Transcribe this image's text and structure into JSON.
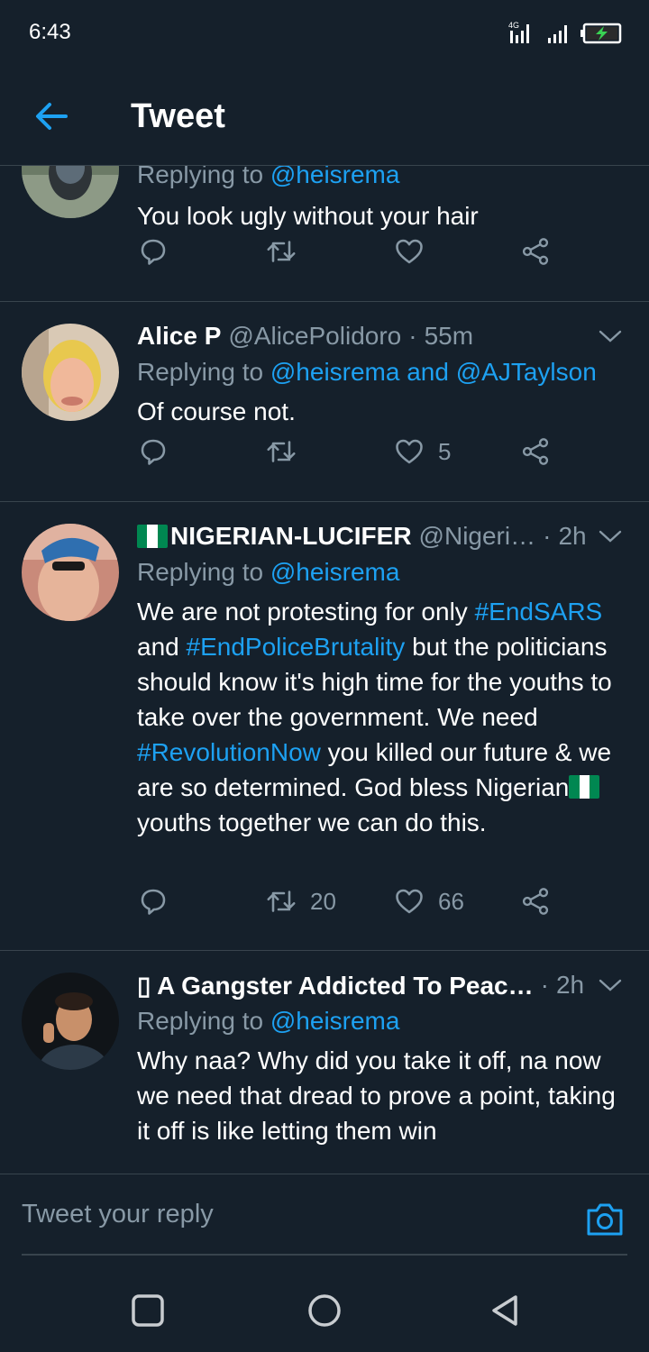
{
  "status_bar": {
    "time": "6:43",
    "network": "4G"
  },
  "header": {
    "title": "Tweet"
  },
  "tweets": [
    {
      "reply_prefix": "Replying to",
      "reply_to": "@heisrema",
      "text": "You look ugly without your hair"
    },
    {
      "name": "Alice P",
      "handle": "@AlicePolidoro",
      "sep": "·",
      "time": "55m",
      "reply_prefix": "Replying to",
      "reply_to": "@heisrema and @AJTaylson",
      "text": "Of course not.",
      "likes": "5"
    },
    {
      "name": "NIGERIAN-LUCIFER",
      "handle": "@Nigeri…",
      "sep": "·",
      "time": "2h",
      "reply_prefix": "Replying to",
      "reply_to": "@heisrema",
      "text_parts": {
        "p1": "We are not protesting for only ",
        "h1": "#EndSARS",
        "p2": " and ",
        "h2": "#EndPoliceBrutality",
        "p3": " but the politicians should know it's high time for the youths to take over the government. We need ",
        "h3": "#RevolutionNow",
        "p4": " you killed our future & we are so determined. God bless Nigerian",
        "p5": " youths together we can do this."
      },
      "retweets": "20",
      "likes": "66"
    },
    {
      "name": "▯ A Gangster Addicted To Peac…",
      "sep": "·",
      "time": "2h",
      "reply_prefix": "Replying to",
      "reply_to": "@heisrema",
      "text": "Why naa? Why did you take it off, na now we need that dread to prove a point, taking it off is like letting them win"
    }
  ],
  "reply_bar": {
    "placeholder": "Tweet your reply"
  },
  "colors": {
    "background": "#15202b",
    "accent": "#1da1f2",
    "muted": "#8899a6",
    "divider": "#38444d",
    "flag_green": "#008751"
  },
  "icons": [
    "back-arrow-icon",
    "signal-icon",
    "battery-charging-icon",
    "reply-icon",
    "retweet-icon",
    "like-icon",
    "share-icon",
    "chevron-down-icon",
    "camera-icon",
    "nav-square-icon",
    "nav-circle-icon",
    "nav-back-triangle-icon"
  ]
}
